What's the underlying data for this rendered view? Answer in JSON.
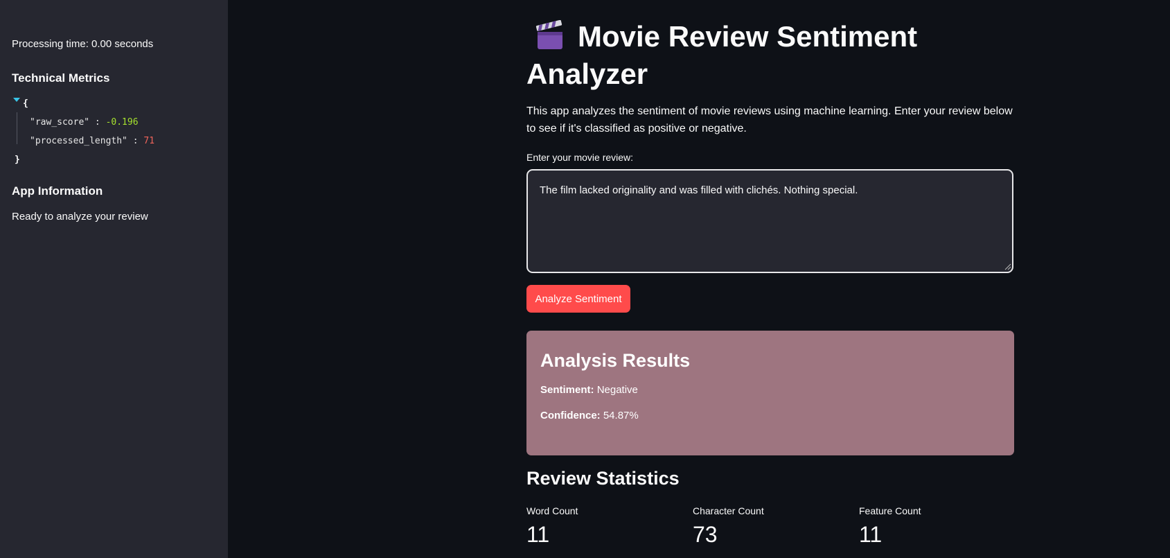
{
  "sidebar": {
    "processing_time": "Processing time: 0.00 seconds",
    "technical_metrics_heading": "Technical Metrics",
    "json": {
      "open_brace": "{",
      "close_brace": "}",
      "raw_score_key": "\"raw_score\"",
      "raw_score_value": "-0.196",
      "processed_length_key": "\"processed_length\"",
      "processed_length_value": "71",
      "colon": ":"
    },
    "app_info_heading": "App Information",
    "app_info_text": "Ready to analyze your review"
  },
  "main": {
    "title_line1": "Movie Review Sentiment",
    "title_line2": "Analyzer",
    "title_icon": "clapper-board-icon",
    "description": "This app analyzes the sentiment of movie reviews using machine learning. Enter your review below to see if it's classified as positive or negative.",
    "input_label": "Enter your movie review:",
    "review_text": "The film lacked originality and was filled with clichés. Nothing special.",
    "analyze_button": "Analyze Sentiment",
    "results": {
      "heading": "Analysis Results",
      "sentiment_label": "Sentiment:",
      "sentiment_value": "Negative",
      "confidence_label": "Confidence:",
      "confidence_value": "54.87%"
    },
    "stats_heading": "Review Statistics",
    "stats": [
      {
        "label": "Word Count",
        "value": "11"
      },
      {
        "label": "Character Count",
        "value": "73"
      },
      {
        "label": "Feature Count",
        "value": "11"
      }
    ]
  },
  "colors": {
    "background": "#0e1117",
    "sidebar": "#262730",
    "accent_button": "#ff4b4b",
    "results_panel": "#9e7580"
  }
}
